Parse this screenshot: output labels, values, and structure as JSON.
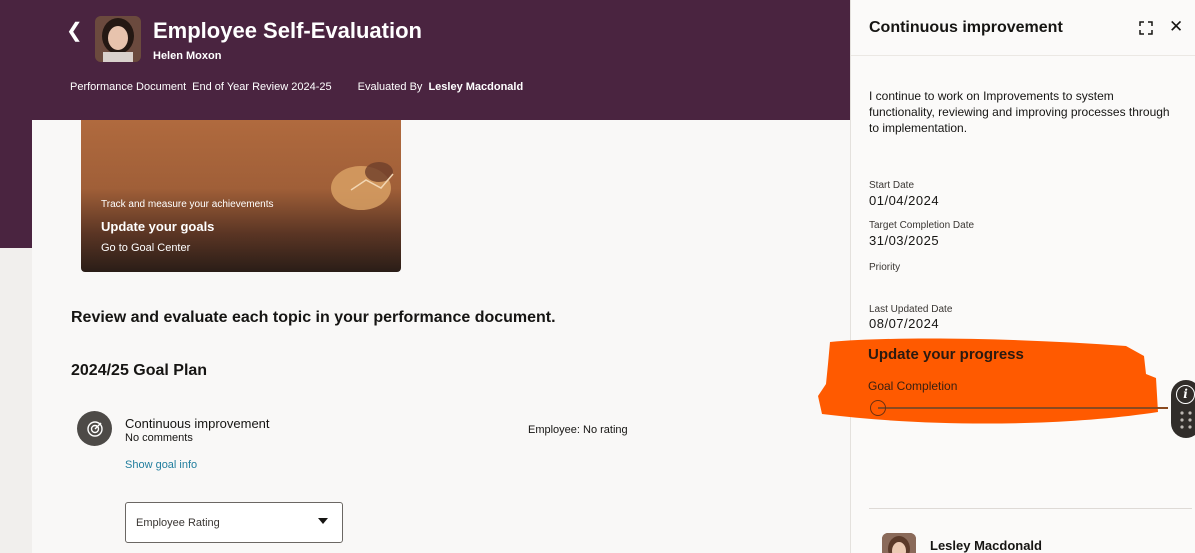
{
  "header": {
    "title": "Employee Self-Evaluation",
    "employee_name": "Helen Moxon",
    "document_label": "Performance Document",
    "document_value": "End of Year Review 2024-25",
    "evaluated_by_label": "Evaluated By",
    "evaluated_by_value": "Lesley Macdonald"
  },
  "goal_card": {
    "kicker": "Track and measure your achievements",
    "title": "Update your goals",
    "link": "Go to Goal Center"
  },
  "main": {
    "instructions": "Review and evaluate each topic in your performance document.",
    "plan_title": "2024/25 Goal Plan",
    "goal": {
      "name": "Continuous improvement",
      "comments": "No comments",
      "employee_rating": "Employee: No rating",
      "show_info": "Show goal info",
      "rating_select_label": "Employee Rating"
    }
  },
  "drawer": {
    "title": "Continuous improvement",
    "description": "I continue to work on Improvements to system functionality, reviewing and improving processes through to implementation.",
    "start_date_label": "Start Date",
    "start_date": "01/04/2024",
    "target_date_label": "Target Completion Date",
    "target_date": "31/03/2025",
    "priority_label": "Priority",
    "last_updated_label": "Last Updated Date",
    "last_updated": "08/07/2024",
    "progress_title": "Update your progress",
    "goal_completion_label": "Goal Completion",
    "goal_completion_value": 0,
    "evaluator_name": "Lesley Macdonald"
  },
  "colors": {
    "header_bg": "#4a2440",
    "link": "#227e9e",
    "redaction": "#ff5a00"
  },
  "icons": {
    "back": "chevron-left-icon",
    "expand": "expand-icon",
    "close": "close-icon",
    "info": "info-icon",
    "grip": "grip-icon",
    "goal": "target-icon"
  }
}
